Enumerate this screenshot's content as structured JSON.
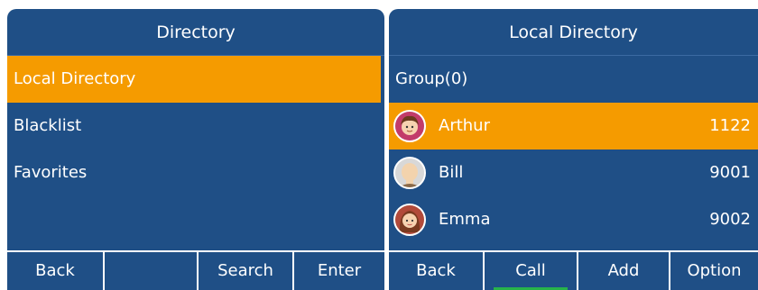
{
  "colors": {
    "background": "#1f4f86",
    "highlight": "#f59b00",
    "text": "#ffffff",
    "active_underline": "#27b24a"
  },
  "left_pane": {
    "title": "Directory",
    "items": [
      {
        "label": "Local Directory",
        "selected": true
      },
      {
        "label": "Blacklist",
        "selected": false
      },
      {
        "label": "Favorites",
        "selected": false
      }
    ]
  },
  "right_pane": {
    "title": "Local Directory",
    "group_label": "Group(0)",
    "contacts": [
      {
        "name": "Arthur",
        "number": "1122",
        "avatar": "cartoon-boy-avatar-icon",
        "selected": true
      },
      {
        "name": "Bill",
        "number": "9001",
        "avatar": "bald-man-avatar-icon",
        "selected": false
      },
      {
        "name": "Emma",
        "number": "9002",
        "avatar": "girl-avatar-icon",
        "selected": false
      }
    ]
  },
  "softkeys_left": [
    "Back",
    "",
    "Search",
    "Enter"
  ],
  "softkeys_right": [
    "Back",
    "Call",
    "Add",
    "Option"
  ]
}
